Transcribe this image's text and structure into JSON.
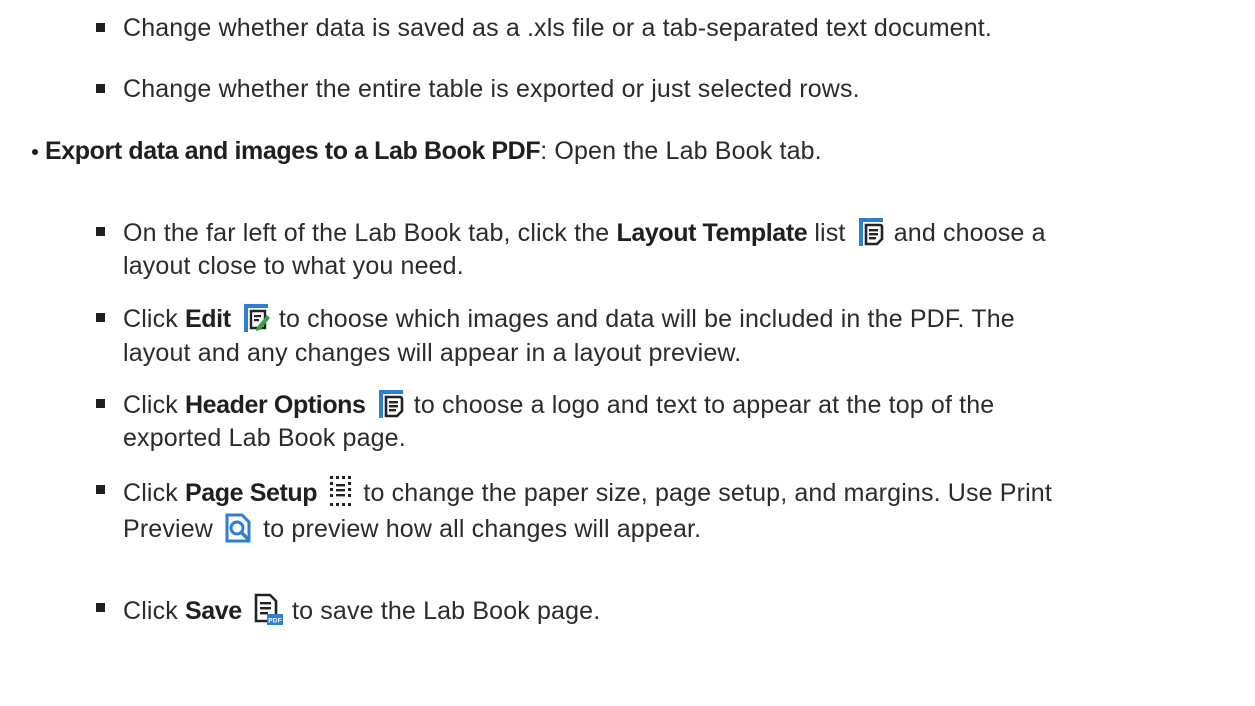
{
  "save_format_item": "Change whether data is saved as a .xls file or a tab-separated text document.",
  "export_scope_item": "Change whether the entire table is exported or just selected rows.",
  "lab_book": {
    "heading": "Export data and images to a Lab Book PDF",
    "heading_suffix": ": Open the Lab Book tab.",
    "steps": {
      "layout_template": {
        "pre": "On the far left of the Lab Book tab, click the ",
        "bold": "Layout Template",
        "mid": " list",
        "post": " and choose a",
        "cont": "layout close to what you need.",
        "icon": "layout-template-icon"
      },
      "edit": {
        "pre": "Click ",
        "bold": "Edit",
        "post": " to choose which images and data will be included in the PDF. The",
        "cont": "layout and any changes will appear in a layout preview.",
        "icon": "edit-layout-icon"
      },
      "header_options": {
        "pre": "Click ",
        "bold": "Header Options",
        "post": " to choose a logo and text to appear at the top of the",
        "cont": "exported Lab Book page.",
        "icon": "header-options-icon"
      },
      "page_setup": {
        "pre": "Click ",
        "bold": "Page Setup",
        "post": " to change the paper size, page setup, and margins. Use Print",
        "cont_pre": "Preview",
        "cont_post": " to preview how all changes will appear.",
        "icon": "page-setup-icon",
        "icon2": "print-preview-icon"
      },
      "save": {
        "pre": "Click ",
        "bold": "Save",
        "post": " to save the Lab Book page.",
        "icon": "save-pdf-icon",
        "icon_badge": "PDF"
      }
    }
  },
  "colors": {
    "text": "#2b2b2b",
    "icon_blue": "#2f7fd0",
    "icon_green": "#3aa04a"
  }
}
